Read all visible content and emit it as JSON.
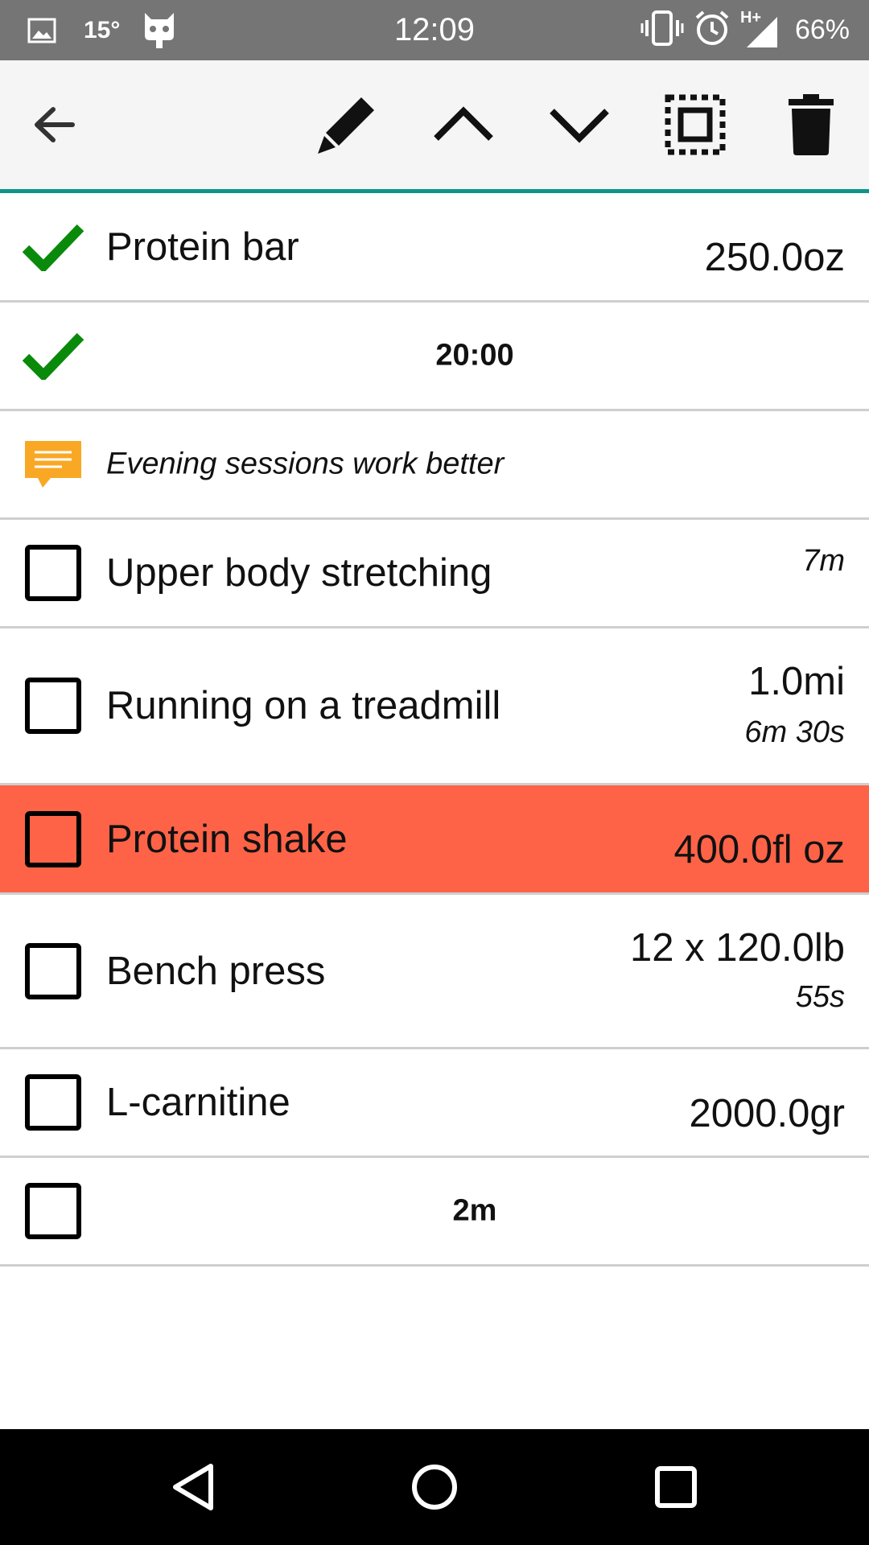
{
  "status_bar": {
    "temperature": "15°",
    "time": "12:09",
    "network": "H+",
    "battery": "66%",
    "icons": [
      "image-icon",
      "robot-icon",
      "vibrate-icon",
      "alarm-icon",
      "signal-icon"
    ]
  },
  "toolbar": {
    "icons": [
      "back-arrow-icon",
      "edit-icon",
      "move-up-icon",
      "move-down-icon",
      "select-all-icon",
      "delete-icon"
    ]
  },
  "colors": {
    "status_bar_bg": "#757575",
    "toolbar_bg": "#f5f5f5",
    "toolbar_underline": "#109488",
    "check_green": "#0a8a0a",
    "note_amber": "#f9a825",
    "highlight_row": "#ff6347"
  },
  "rows": [
    {
      "type": "checked",
      "name": "Protein bar",
      "value": "250.0oz"
    },
    {
      "type": "checked-center",
      "center": "20:00"
    },
    {
      "type": "note",
      "name": "Evening sessions work better"
    },
    {
      "type": "unchecked",
      "name": "Upper body stretching",
      "sub": "7m"
    },
    {
      "type": "unchecked",
      "name": "Running on a treadmill",
      "value": "1.0mi",
      "sub": "6m 30s"
    },
    {
      "type": "unchecked",
      "name": "Protein shake",
      "value": "400.0fl oz",
      "highlighted": true
    },
    {
      "type": "unchecked",
      "name": "Bench press",
      "value": "12 x 120.0lb",
      "sub": "55s"
    },
    {
      "type": "unchecked",
      "name": "L-carnitine",
      "value": "2000.0gr"
    },
    {
      "type": "unchecked-center",
      "center": "2m"
    }
  ],
  "nav_bar": {
    "icons": [
      "nav-back-icon",
      "nav-home-icon",
      "nav-recents-icon"
    ]
  }
}
